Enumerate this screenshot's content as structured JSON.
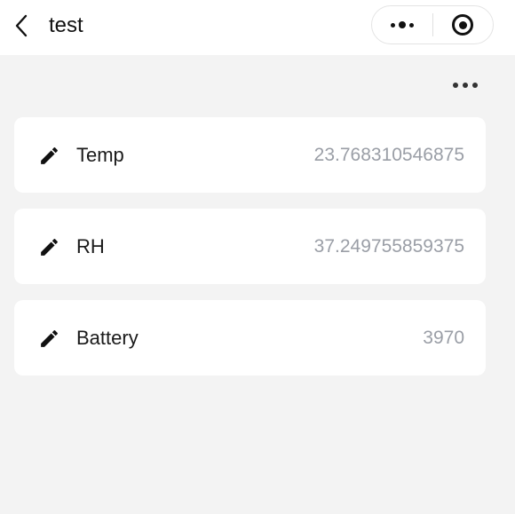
{
  "header": {
    "title": "test",
    "back_icon": "chevron-left-icon",
    "capsule": {
      "menu_icon": "more-dots-icon",
      "close_icon": "target-circle-icon"
    }
  },
  "more_menu_icon": "ellipsis-icon",
  "items": [
    {
      "label": "Temp",
      "value": "23.768310546875",
      "icon": "pencil-edit-icon"
    },
    {
      "label": "RH",
      "value": "37.249755859375",
      "icon": "pencil-edit-icon"
    },
    {
      "label": "Battery",
      "value": "3970",
      "icon": "pencil-edit-icon"
    }
  ],
  "colors": {
    "background": "#f3f3f3",
    "card": "#ffffff",
    "label": "#1a1a1a",
    "value": "#9a9ea6"
  }
}
